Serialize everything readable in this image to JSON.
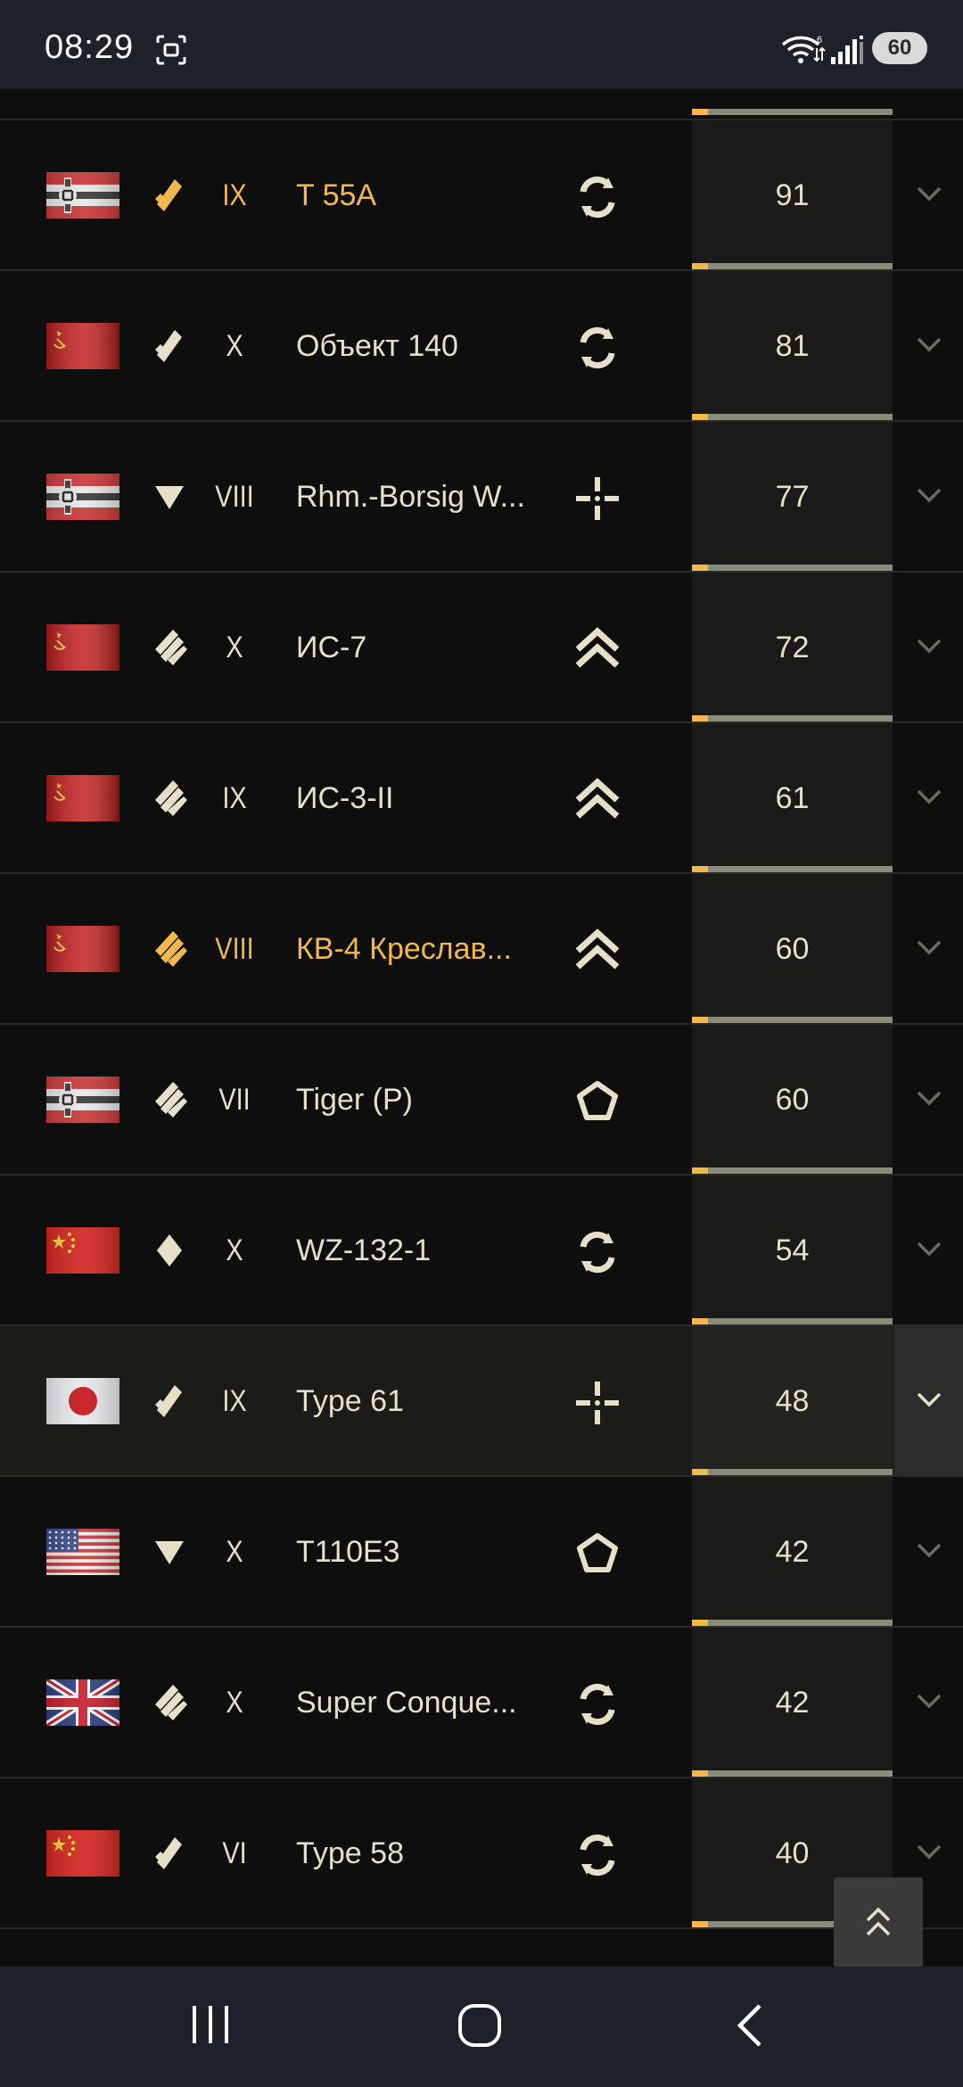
{
  "status_bar": {
    "time": "08:29",
    "battery": "60",
    "icons": [
      "screenshot-icon",
      "wifi-icon",
      "signal-icon",
      "battery-icon"
    ]
  },
  "colors": {
    "background": "#0e0e0e",
    "row_highlight": "#1b1b18",
    "text": "#e6e0c9",
    "accent_gold": "#f2b84b",
    "progress_track": "#8b8b7a",
    "score_cell": "#1a1a18",
    "system_bar": "#1f212a"
  },
  "rows": [
    {
      "nation": "germany",
      "role": "medium-tank-icon",
      "tier": "IX",
      "name": "T 55A",
      "type": "universal-role-icon",
      "score": "91",
      "progress": 0.08,
      "premium": true,
      "highlighted": false
    },
    {
      "nation": "ussr",
      "role": "medium-tank-icon",
      "tier": "X",
      "name": "Объект 140",
      "type": "universal-role-icon",
      "score": "81",
      "progress": 0.08,
      "premium": false,
      "highlighted": false
    },
    {
      "nation": "germany",
      "role": "tank-destroyer-icon",
      "tier": "VIII",
      "name": "Rhm.-Borsig W...",
      "type": "sniper-role-icon",
      "score": "77",
      "progress": 0.08,
      "premium": false,
      "highlighted": false
    },
    {
      "nation": "ussr",
      "role": "heavy-tank-icon",
      "tier": "X",
      "name": "ИС-7",
      "type": "assault-role-icon",
      "score": "72",
      "progress": 0.08,
      "premium": false,
      "highlighted": false
    },
    {
      "nation": "ussr",
      "role": "heavy-tank-icon",
      "tier": "IX",
      "name": "ИС-3-II",
      "type": "assault-role-icon",
      "score": "61",
      "progress": 0.08,
      "premium": false,
      "highlighted": false
    },
    {
      "nation": "ussr",
      "role": "heavy-tank-icon",
      "tier": "VIII",
      "name": "КВ-4 Креслав...",
      "type": "assault-role-icon",
      "score": "60",
      "progress": 0.08,
      "premium": true,
      "highlighted": false
    },
    {
      "nation": "germany",
      "role": "heavy-tank-icon",
      "tier": "VII",
      "name": "Tiger (P)",
      "type": "defensive-role-icon",
      "score": "60",
      "progress": 0.08,
      "premium": false,
      "highlighted": false
    },
    {
      "nation": "china",
      "role": "light-tank-icon",
      "tier": "X",
      "name": "WZ-132-1",
      "type": "universal-role-icon",
      "score": "54",
      "progress": 0.08,
      "premium": false,
      "highlighted": false
    },
    {
      "nation": "japan",
      "role": "medium-tank-icon",
      "tier": "IX",
      "name": "Type 61",
      "type": "sniper-role-icon",
      "score": "48",
      "progress": 0.08,
      "premium": false,
      "highlighted": true
    },
    {
      "nation": "usa",
      "role": "tank-destroyer-icon",
      "tier": "X",
      "name": "T110E3",
      "type": "defensive-role-icon",
      "score": "42",
      "progress": 0.08,
      "premium": false,
      "highlighted": false
    },
    {
      "nation": "uk",
      "role": "heavy-tank-icon",
      "tier": "X",
      "name": "Super Conque...",
      "type": "universal-role-icon",
      "score": "42",
      "progress": 0.08,
      "premium": false,
      "highlighted": false
    },
    {
      "nation": "china",
      "role": "medium-tank-icon",
      "tier": "VI",
      "name": "Type 58",
      "type": "universal-role-icon",
      "score": "40",
      "progress": 0.08,
      "premium": false,
      "highlighted": false
    }
  ],
  "navigation": [
    "recent-apps-icon",
    "home-icon",
    "back-icon"
  ]
}
